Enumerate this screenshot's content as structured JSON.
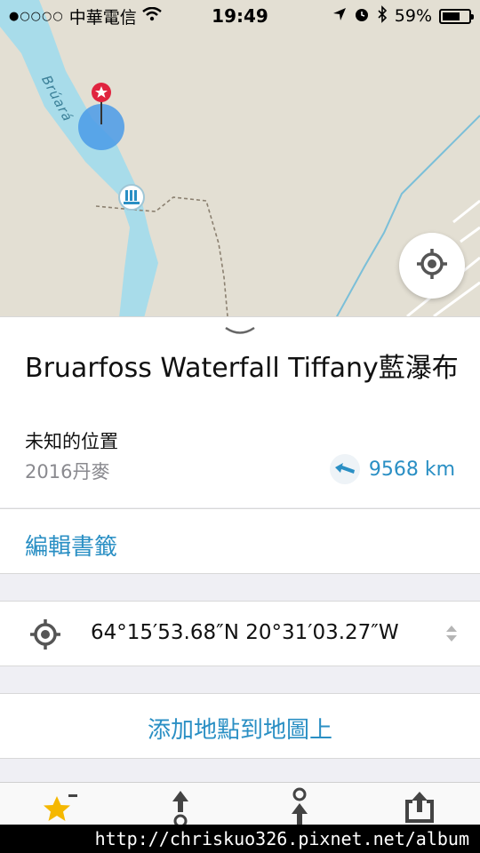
{
  "status_bar": {
    "carrier": "中華電信",
    "time": "19:49",
    "battery_text": "59%",
    "battery_level": 0.59
  },
  "map": {
    "river_label": "Brúará"
  },
  "place": {
    "title": "Bruarfoss Waterfall Tiffany藍瀑布",
    "subtitle": "未知的位置",
    "folder": "2016丹麥",
    "distance": "9568 km"
  },
  "actions": {
    "edit_bookmark": "編輯書籤",
    "coordinates": "64°15′53.68″N 20°31′03.27″W",
    "add_to_map": "添加地點到地圖上"
  },
  "watermark": "http://chriskuo326.pixnet.net/album",
  "colors": {
    "accent": "#2a8fc4",
    "river": "#a8dcea",
    "map_bg": "#e3dfd3",
    "pin": "#e0243f",
    "star": "#f5b800"
  }
}
